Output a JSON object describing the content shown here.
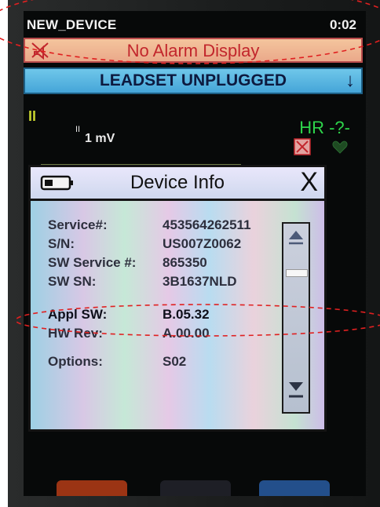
{
  "status_bar": {
    "device_name": "NEW_DEVICE",
    "clock": "0:02"
  },
  "alarm_bar": {
    "text": "No Alarm Display",
    "icon": "alarm-off-icon"
  },
  "leadset_bar": {
    "text": "LEADSET UNPLUGGED",
    "arrow": "↓"
  },
  "waveform": {
    "lead_mark_1": "II",
    "lead_mark_2": "II",
    "scale": "1 mV",
    "hr_label": "HR -?-"
  },
  "device_info": {
    "title": "Device Info",
    "close": "X",
    "rows": [
      {
        "key": "Service#:",
        "value": "453564262511"
      },
      {
        "key": "S/N:",
        "value": "US007Z0062"
      },
      {
        "key": "SW Service #:",
        "value": "865350"
      },
      {
        "key": "SW SN:",
        "value": "3B1637NLD"
      },
      {
        "key": "Appl SW:",
        "value": "B.05.32"
      },
      {
        "key": "HW Rev:",
        "value": "A.00.00"
      },
      {
        "key": "Options:",
        "value": "S02"
      }
    ]
  },
  "colors": {
    "alarm_background": "#f0b895",
    "alarm_text": "#c2262c",
    "leadset_background": "#57b5e1",
    "hr_green": "#2ed54b",
    "annotation_red": "#e02020"
  }
}
